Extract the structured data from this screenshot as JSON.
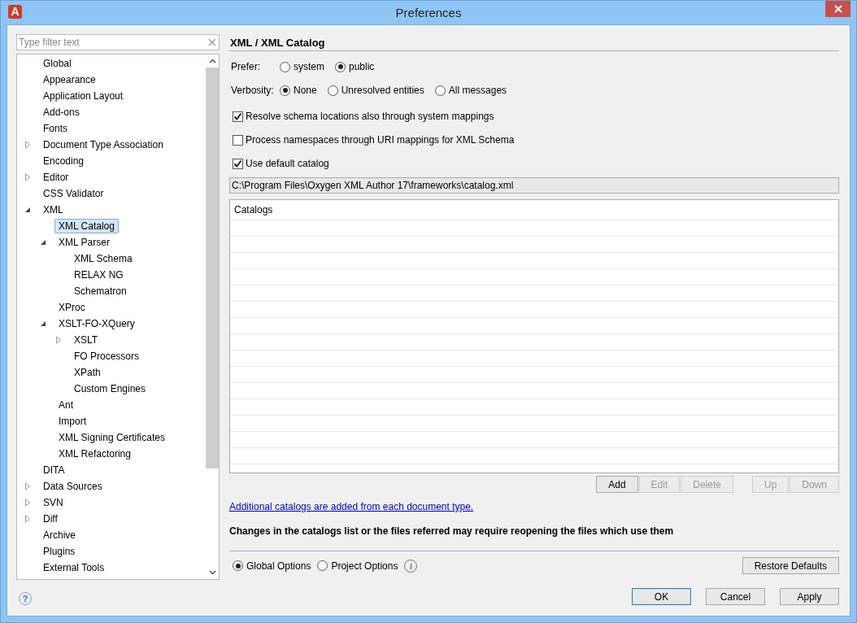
{
  "window": {
    "title": "Preferences",
    "app_icon_letter": "A"
  },
  "filter": {
    "placeholder": "Type filter text"
  },
  "tree": [
    {
      "label": "Global",
      "selected": false
    },
    {
      "label": "Appearance",
      "selected": false
    },
    {
      "label": "Application Layout",
      "selected": false
    },
    {
      "label": "Add-ons",
      "selected": false
    },
    {
      "label": "Fonts",
      "selected": false
    },
    {
      "label": "Document Type Association",
      "selected": false,
      "expanded": false
    },
    {
      "label": "Encoding",
      "selected": false
    },
    {
      "label": "Editor",
      "selected": false,
      "expanded": false
    },
    {
      "label": "CSS Validator",
      "selected": false
    },
    {
      "label": "XML",
      "selected": false,
      "expanded": true,
      "children": [
        {
          "label": "XML Catalog",
          "selected": true
        },
        {
          "label": "XML Parser",
          "selected": false,
          "expanded": true,
          "children": [
            {
              "label": "XML Schema",
              "selected": false
            },
            {
              "label": "RELAX NG",
              "selected": false
            },
            {
              "label": "Schematron",
              "selected": false
            }
          ]
        },
        {
          "label": "XProc",
          "selected": false
        },
        {
          "label": "XSLT-FO-XQuery",
          "selected": false,
          "expanded": true,
          "children": [
            {
              "label": "XSLT",
              "selected": false,
              "expanded": false
            },
            {
              "label": "FO Processors",
              "selected": false
            },
            {
              "label": "XPath",
              "selected": false
            },
            {
              "label": "Custom Engines",
              "selected": false
            }
          ]
        },
        {
          "label": "Ant",
          "selected": false
        },
        {
          "label": "Import",
          "selected": false
        },
        {
          "label": "XML Signing Certificates",
          "selected": false
        },
        {
          "label": "XML Refactoring",
          "selected": false
        }
      ]
    },
    {
      "label": "DITA",
      "selected": false
    },
    {
      "label": "Data Sources",
      "selected": false,
      "expanded": false
    },
    {
      "label": "SVN",
      "selected": false,
      "expanded": false
    },
    {
      "label": "Diff",
      "selected": false,
      "expanded": false
    },
    {
      "label": "Archive",
      "selected": false
    },
    {
      "label": "Plugins",
      "selected": false
    },
    {
      "label": "External Tools",
      "selected": false
    }
  ],
  "help": "?",
  "page": {
    "title": "XML / XML Catalog",
    "radio_groups": [
      {
        "label": "Prefer:",
        "options": [
          {
            "label": "system",
            "selected": false
          },
          {
            "label": "public",
            "selected": true
          }
        ]
      },
      {
        "label": "Verbosity:",
        "options": [
          {
            "label": "None",
            "selected": true
          },
          {
            "label": "Unresolved entities",
            "selected": false
          },
          {
            "label": "All messages",
            "selected": false
          }
        ]
      }
    ],
    "checkboxes": [
      {
        "label": "Resolve schema locations also through system mappings",
        "checked": true
      },
      {
        "label": "Process namespaces through URI mappings for XML Schema",
        "checked": false
      },
      {
        "label": "Use default catalog",
        "checked": true
      }
    ],
    "catalog_path": "C:\\Program Files\\Oxygen XML Author 17\\frameworks\\catalog.xml",
    "table": {
      "columns": [
        "Catalogs"
      ]
    },
    "button_groups": [
      [
        {
          "label": "Add",
          "disabled": false
        },
        {
          "label": "Edit",
          "disabled": true
        },
        {
          "label": "Delete",
          "disabled": true
        }
      ],
      [
        {
          "label": "Up",
          "disabled": true
        },
        {
          "label": "Down",
          "disabled": true
        }
      ]
    ],
    "link": "Additional catalogs are added from each document type.",
    "note": "Changes in the catalogs list or the files referred may require reopening the files which use them"
  },
  "scope_options": [
    {
      "label": "Global Options",
      "selected": true
    },
    {
      "label": "Project Options",
      "selected": false
    }
  ],
  "info": "i",
  "restore_button": "Restore Defaults",
  "dialog_buttons": [
    {
      "label": "OK",
      "default": true
    },
    {
      "label": "Cancel",
      "default": false
    },
    {
      "label": "Apply",
      "default": false
    }
  ]
}
